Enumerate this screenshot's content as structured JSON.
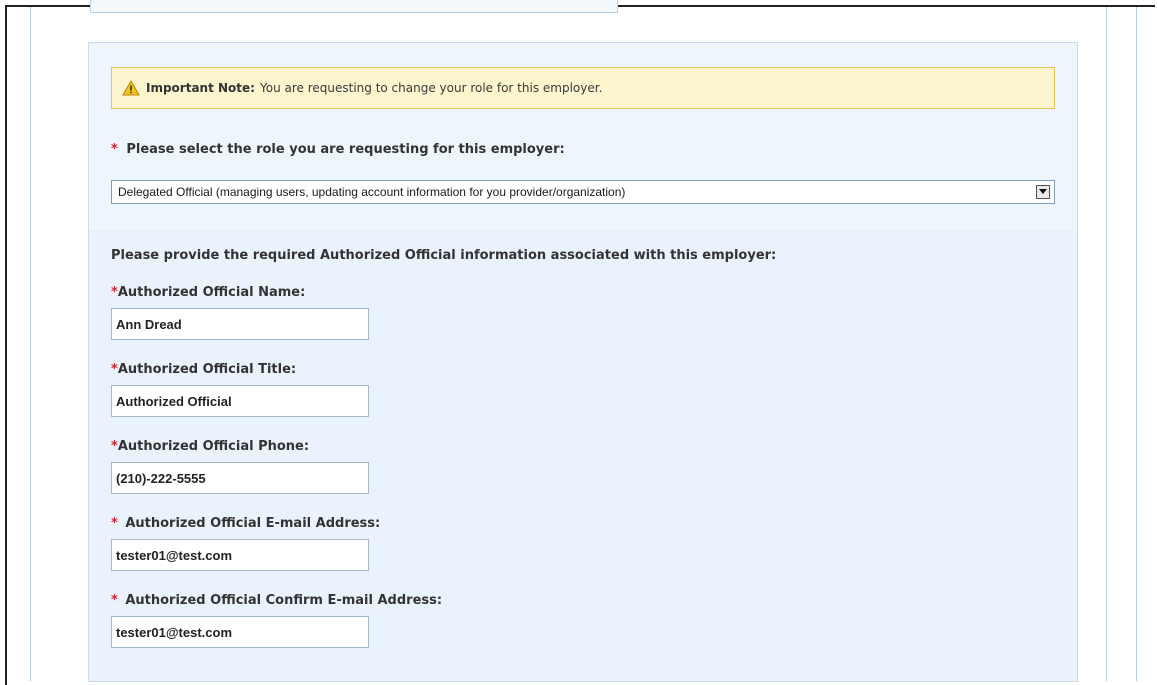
{
  "note": {
    "title": "Important Note:",
    "text": "You are requesting to change your role for this employer."
  },
  "role": {
    "required_marker": "*",
    "label": "Please select the role you are requesting for this employer:",
    "selected_value": "Delegated Official (managing users, updating account information for you provider/organization)"
  },
  "authorized_section": {
    "intro": "Please provide the required Authorized Official information associated with this employer:",
    "fields": [
      {
        "marker": "*",
        "label": "Authorized Official Name:",
        "value": "Ann Dread"
      },
      {
        "marker": "*",
        "label": "Authorized Official Title:",
        "value": "Authorized Official"
      },
      {
        "marker": "*",
        "label": "Authorized Official Phone:",
        "value": "(210)-222-5555"
      },
      {
        "marker": "*",
        "label": "Authorized Official E-mail Address:",
        "value": "tester01@test.com"
      },
      {
        "marker": "*",
        "label": "Authorized Official Confirm E-mail Address:",
        "value": "tester01@test.com"
      }
    ]
  },
  "colors": {
    "required": "#d6212e",
    "panel_bg": "#eef5fc",
    "note_bg": "#fcf5cd",
    "note_border": "#e6c55a"
  },
  "icons": {
    "note": "warning-triangle-icon",
    "select": "dropdown-arrow-icon"
  }
}
